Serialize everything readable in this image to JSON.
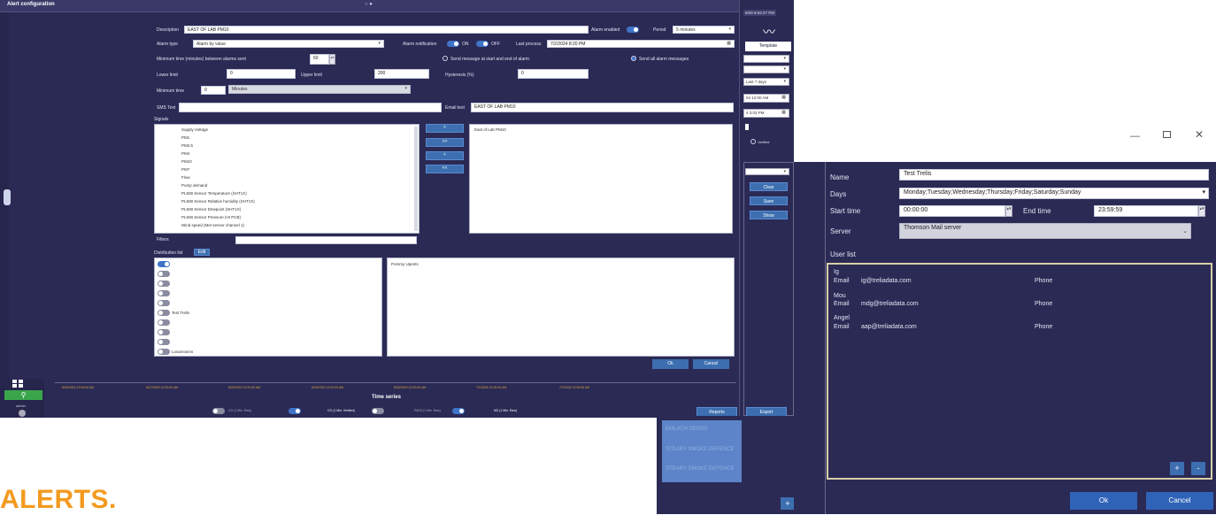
{
  "main_window": {
    "title": "Alert configuration",
    "description_label": "Description",
    "description_value": "EAST OF LAB PM10",
    "alarm_enabled_label": "Alarm enabled",
    "period_label": "Period",
    "period_value": "5 minutes",
    "alarm_type_label": "Alarm type",
    "alarm_type_value": "Alarm by value",
    "alarm_notification_label": "Alarm notification",
    "on_label": "ON",
    "off_label": "OFF",
    "last_process_label": "Last process",
    "last_process_value": "7/2/2024 8:20 PM",
    "min_time_between_label": "Minimum time (minutes) between alarms sent",
    "min_time_between_value": "60",
    "send_start_end_label": "Send message at start and end of alarm",
    "send_all_label": "Send all alarm messages",
    "lower_limit_label": "Lower limit",
    "lower_limit_value": "0",
    "upper_limit_label": "Upper limit",
    "upper_limit_value": "200",
    "hysteresis_label": "Hysteresis (%)",
    "hysteresis_value": "0",
    "minimum_time_label": "Minimum time",
    "minimum_time_value": "0",
    "minimum_time_unit": "Minutes",
    "sms_text_label": "SMS Text",
    "email_text_label": "Email text",
    "email_text_value": "EAST OF LAB PM10",
    "signals_label": "Signals",
    "signals": [
      "Supply Voltage",
      "PM1",
      "PM2.5",
      "PM4",
      "PM10",
      "PM?",
      "Flow",
      "Pump demand",
      "PL508 Sensor Temperature (SHT1X)",
      "PL508 Sensor Relative humidity (SHT1X)",
      "PL508 Sensor Dewpoint (SHT1X)",
      "PL508 Sensor Pressure (HI PCB)",
      "Wind speed (Met sensor channel 1)"
    ],
    "selected_signals": [
      "East of Lab PM10"
    ],
    "move_buttons": [
      ">",
      ">>",
      "<",
      "<<"
    ],
    "filters_label": "Filters",
    "distribution_list_label": "Distribution list",
    "edit_button": "Edit",
    "distribution_item_label_1": "Test Trelis",
    "distribution_item_label_2": "Losamosms",
    "recipients_text": "Pommy Upents",
    "ok_button": "Ok",
    "cancel_button": "Cancel"
  },
  "timeline": {
    "title": "Time series",
    "ticks": [
      "8/26/2024 12:00:00 AM",
      "8/27/2024 12:00:00 AM",
      "8/28/2024 12:00:00 AM",
      "8/29/2024 12:00:00 AM",
      "8/30/2024 12:00:00 AM",
      "7/1/2024 12:00:00 AM",
      "7/2/2024 12:00:00 AM"
    ],
    "legend": [
      "CO (1 Min. Raw)",
      "CO (1 Min. Verified)",
      "PM10 (1 Min. Raw)",
      "NO (1 Min. Raw)"
    ],
    "user_label": "admin"
  },
  "side_panel": {
    "datetime": "8/28 8:52:27 PM",
    "template_button": "Template",
    "range_value": "Last 7 days",
    "from_value": "04 12:00 AM",
    "to_value": "4 3:03 PM",
    "verified_label": "Verified",
    "clear_button": "Clear",
    "save_button": "Save",
    "show_button": "Show",
    "reports_button": "Reports",
    "export_button": "Export"
  },
  "background_window": {
    "items": [
      "EMLACH DEPOS",
      "STEARY SMOKE DEFENCE",
      "STEARY SMOKE DEFENCE"
    ]
  },
  "user_window": {
    "name_label": "Name",
    "name_value": "Test Trelis",
    "days_label": "Days",
    "days_value": "Monday;Tuesday;Wednesday;Thursday;Friday;Saturday;Sunday",
    "start_time_label": "Start time",
    "start_time_value": "00:00:00",
    "end_time_label": "End time",
    "end_time_value": "23:59:59",
    "server_label": "Server",
    "server_value": "Thomson Mail server",
    "user_list_label": "User list",
    "users": [
      {
        "name": "Ig",
        "email_label": "Email",
        "email": "ig@treliadata.com",
        "phone_label": "Phone"
      },
      {
        "name": "Mou",
        "email_label": "Email",
        "email": "mdg@treliadata.com",
        "phone_label": "Phone"
      },
      {
        "name": "Angel",
        "email_label": "Email",
        "email": "aap@treliadata.com",
        "phone_label": "Phone"
      }
    ],
    "ok_button": "Ok",
    "cancel_button": "Cancel"
  },
  "page_heading": "ALERTS."
}
